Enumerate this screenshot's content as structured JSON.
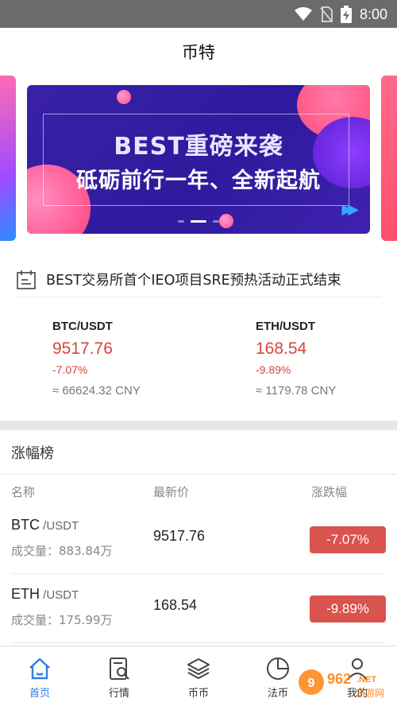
{
  "status_bar": {
    "time": "8:00",
    "icons": [
      "wifi-icon",
      "no-sim-icon",
      "battery-charging-icon"
    ]
  },
  "app": {
    "title": "币特"
  },
  "banner": {
    "headline": "BEST重磅来袭",
    "subline": "砥砺前行一年、全新起航",
    "dots": 3,
    "active_dot": 1,
    "colors": {
      "bg": "#2e1a9c",
      "accent_pink": "#ff5a8a",
      "accent_blue": "#3aa6ff"
    }
  },
  "notice": {
    "icon": "announcement-icon",
    "text": "BEST交易所首个IEO项目SRE预热活动正式结束"
  },
  "tickers": [
    {
      "pair": "BTC/USDT",
      "price": "9517.76",
      "change": "-7.07%",
      "cny": "≈ 66624.32 CNY"
    },
    {
      "pair": "ETH/USDT",
      "price": "168.54",
      "change": "-9.89%",
      "cny": "≈ 1179.78 CNY"
    }
  ],
  "gainers": {
    "title": "涨幅榜",
    "columns": [
      "名称",
      "最新价",
      "涨跌幅"
    ],
    "rows": [
      {
        "coin": "BTC",
        "quote": " /USDT",
        "volume": "成交量：883.84万",
        "price": "9517.76",
        "change": "-7.07%"
      },
      {
        "coin": "ETH",
        "quote": " /USDT",
        "volume": "成交量：175.99万",
        "price": "168.54",
        "change": "-9.89%"
      }
    ],
    "colors": {
      "down": "#d9534f",
      "price_red": "#d4463c"
    }
  },
  "tabbar": {
    "items": [
      {
        "label": "首页",
        "icon": "home-icon",
        "active": true
      },
      {
        "label": "行情",
        "icon": "market-search-icon",
        "active": false
      },
      {
        "label": "币币",
        "icon": "layers-icon",
        "active": false
      },
      {
        "label": "法币",
        "icon": "pie-chart-icon",
        "active": false
      },
      {
        "label": "我的",
        "icon": "user-icon",
        "active": false
      }
    ],
    "active_color": "#2b7de9"
  },
  "watermark": {
    "text": "962.NET",
    "subtext": "乐游网"
  }
}
